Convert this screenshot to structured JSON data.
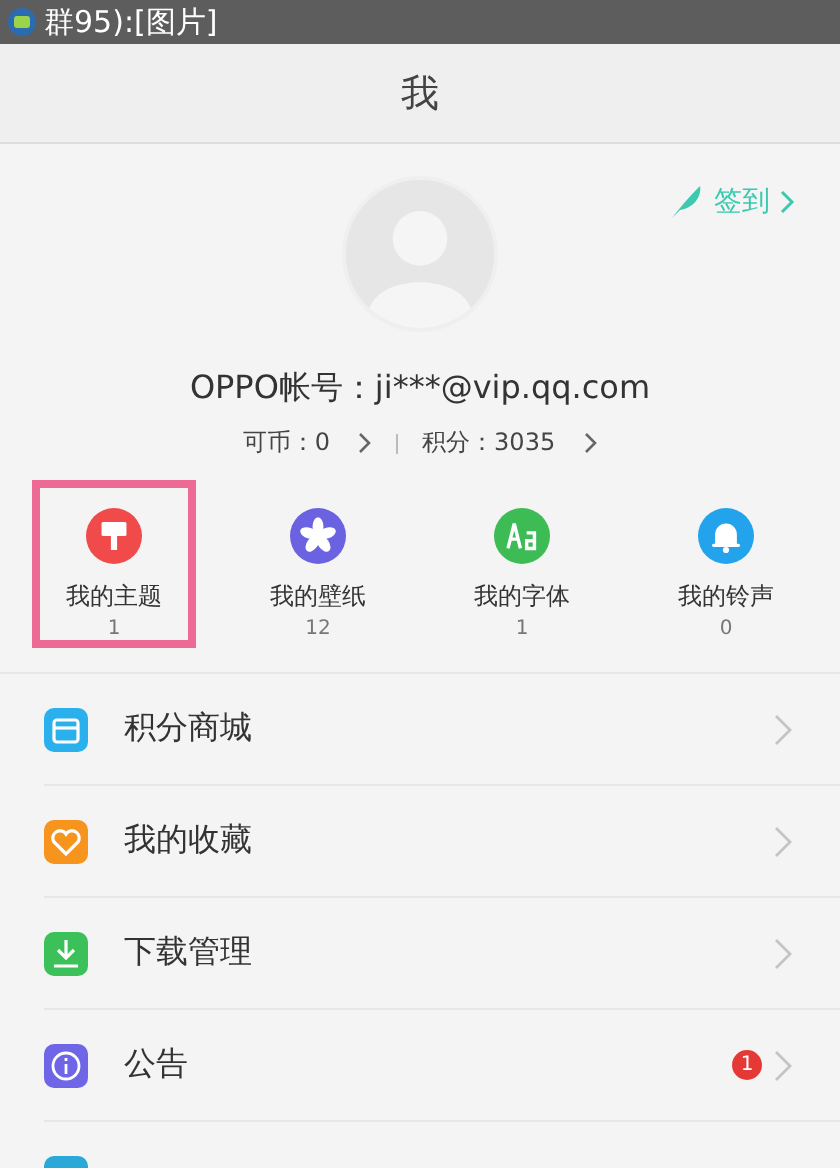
{
  "notification_bar": {
    "text": "群95):[图片]"
  },
  "header": {
    "title": "我"
  },
  "profile": {
    "sign_in": "签到",
    "account": "OPPO帐号：ji***@vip.qq.com",
    "coins": "可币：0",
    "points": "积分：3035"
  },
  "tiles": [
    {
      "kind": "theme",
      "label": "我的主题",
      "count": "1",
      "color": "#f04a4a",
      "selected": true
    },
    {
      "kind": "wallpaper",
      "label": "我的壁纸",
      "count": "12",
      "color": "#6a62e0",
      "selected": false
    },
    {
      "kind": "font",
      "label": "我的字体",
      "count": "1",
      "color": "#3dbb55",
      "selected": false
    },
    {
      "kind": "ringtone",
      "label": "我的铃声",
      "count": "0",
      "color": "#22a3ec",
      "selected": false
    }
  ],
  "menu": [
    {
      "kind": "store",
      "label": "积分商城",
      "color": "#2bb0ee"
    },
    {
      "kind": "favorites",
      "label": "我的收藏",
      "color": "#f7941d"
    },
    {
      "kind": "downloads",
      "label": "下载管理",
      "color": "#3cc05a"
    },
    {
      "kind": "notice",
      "label": "公告",
      "color": "#6e66e6",
      "badge": "1"
    },
    {
      "kind": "other",
      "color": "#2aa9d8"
    }
  ]
}
